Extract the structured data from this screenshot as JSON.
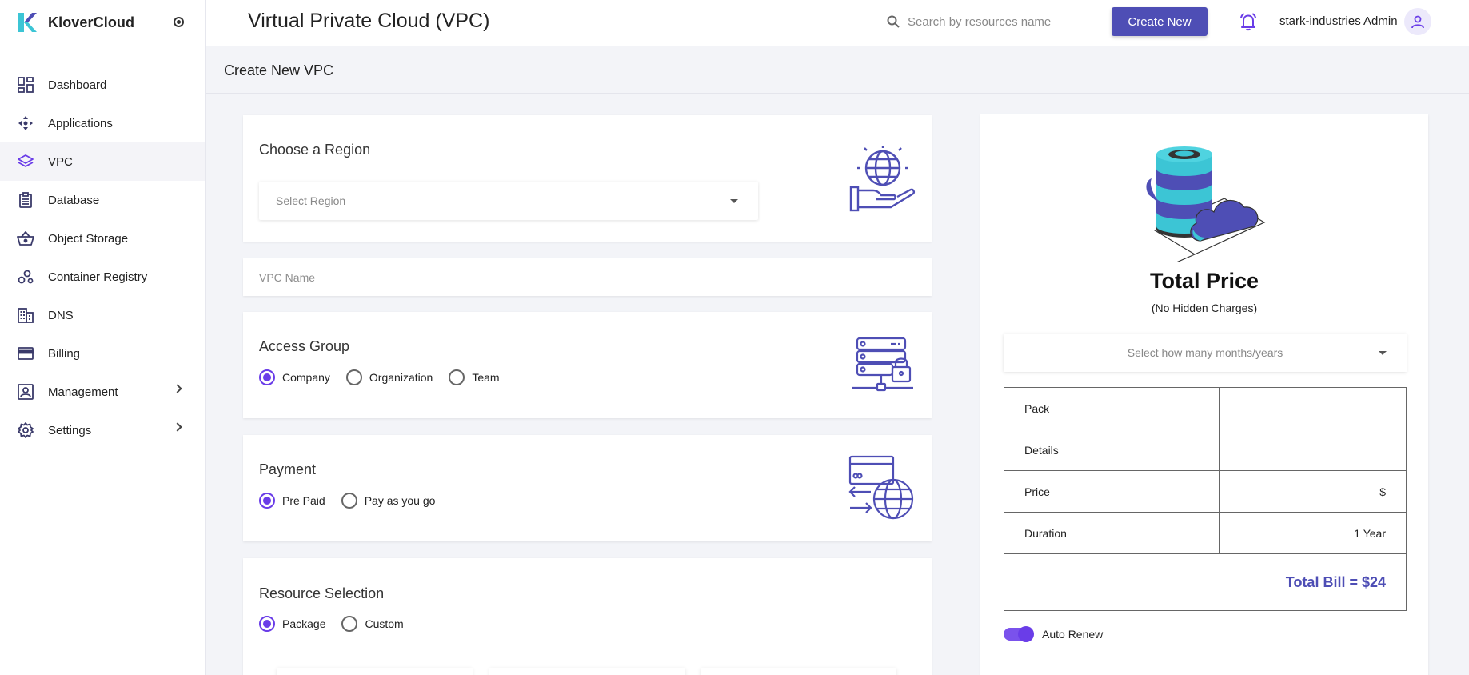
{
  "brand": {
    "name": "KloverCloud"
  },
  "sidebar": {
    "items": [
      {
        "label": "Dashboard",
        "icon": "dashboard-icon"
      },
      {
        "label": "Applications",
        "icon": "applications-icon"
      },
      {
        "label": "VPC",
        "icon": "layers-icon",
        "active": true
      },
      {
        "label": "Database",
        "icon": "database-icon"
      },
      {
        "label": "Object Storage",
        "icon": "basket-icon"
      },
      {
        "label": "Container Registry",
        "icon": "registry-icon"
      },
      {
        "label": "DNS",
        "icon": "building-icon"
      },
      {
        "label": "Billing",
        "icon": "card-icon"
      },
      {
        "label": "Management",
        "icon": "management-icon",
        "expandable": true
      },
      {
        "label": "Settings",
        "icon": "gear-icon",
        "expandable": true
      }
    ]
  },
  "header": {
    "title": "Virtual Private Cloud (VPC)",
    "search_placeholder": "Search by resources name",
    "create_label": "Create New",
    "user": "stark-industries Admin"
  },
  "subheader": {
    "title": "Create New VPC"
  },
  "region": {
    "title": "Choose a Region",
    "placeholder": "Select Region"
  },
  "vpc_name": {
    "placeholder": "VPC Name"
  },
  "access_group": {
    "title": "Access Group",
    "options": [
      "Company",
      "Organization",
      "Team"
    ],
    "selected": "Company"
  },
  "payment": {
    "title": "Payment",
    "options": [
      "Pre Paid",
      "Pay as you go"
    ],
    "selected": "Pre Paid"
  },
  "resource": {
    "title": "Resource Selection",
    "options": [
      "Package",
      "Custom"
    ],
    "selected": "Package"
  },
  "price": {
    "title": "Total Price",
    "subtitle": "(No Hidden Charges)",
    "duration_placeholder": "Select how many months/years",
    "rows": [
      {
        "label": "Pack",
        "value": ""
      },
      {
        "label": "Details",
        "value": ""
      },
      {
        "label": "Price",
        "value": "$"
      },
      {
        "label": "Duration",
        "value": "1 Year"
      }
    ],
    "total": "Total Bill = $24",
    "auto_renew_label": "Auto Renew",
    "auto_renew": true
  },
  "colors": {
    "accent": "#4e4eb5",
    "radio": "#6a3de8",
    "teal": "#3cc5d5"
  }
}
